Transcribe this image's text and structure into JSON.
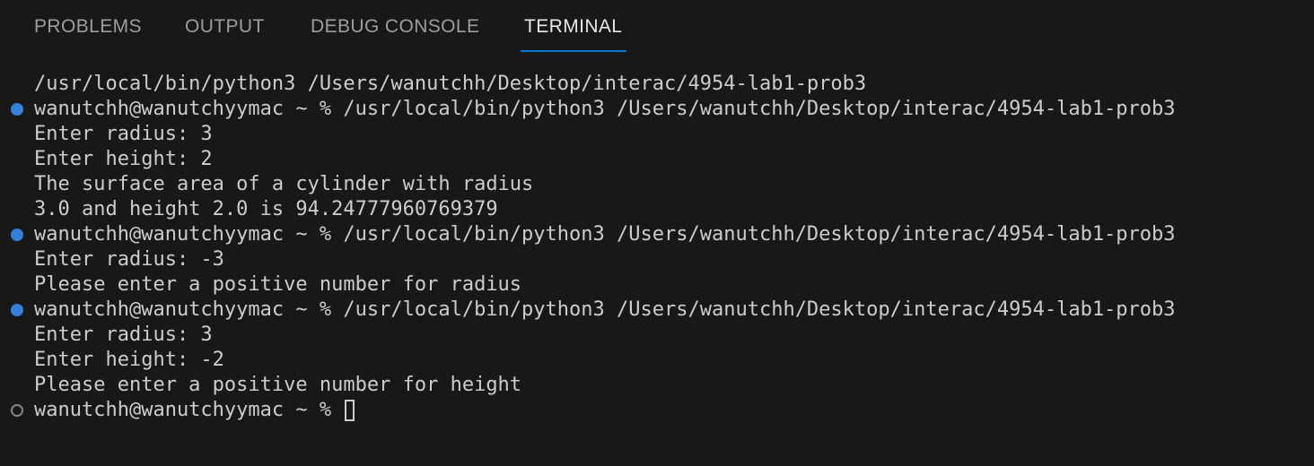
{
  "tabs": [
    {
      "label": "PROBLEMS",
      "active": false
    },
    {
      "label": "OUTPUT",
      "active": false
    },
    {
      "label": "DEBUG CONSOLE",
      "active": false
    },
    {
      "label": "TERMINAL",
      "active": true
    }
  ],
  "colors": {
    "background": "#181818",
    "text": "#cccccc",
    "active_tab_underline": "#0078d4",
    "success_decoration": "#3794ff"
  },
  "terminal": {
    "lines": [
      {
        "text": "/usr/local/bin/python3 /Users/wanutchh/Desktop/interac/4954-lab1-prob3",
        "decoration": "none"
      },
      {
        "text": "wanutchh@wanutchyymac ~ % /usr/local/bin/python3 /Users/wanutchh/Desktop/interac/4954-lab1-prob3",
        "decoration": "success"
      },
      {
        "text": "Enter radius: 3",
        "decoration": "none"
      },
      {
        "text": "Enter height: 2",
        "decoration": "none"
      },
      {
        "text": "The surface area of a cylinder with radius",
        "decoration": "none"
      },
      {
        "text": "3.0 and height 2.0 is 94.24777960769379",
        "decoration": "none"
      },
      {
        "text": "wanutchh@wanutchyymac ~ % /usr/local/bin/python3 /Users/wanutchh/Desktop/interac/4954-lab1-prob3",
        "decoration": "success"
      },
      {
        "text": "Enter radius: -3",
        "decoration": "none"
      },
      {
        "text": "Please enter a positive number for radius",
        "decoration": "none"
      },
      {
        "text": "wanutchh@wanutchyymac ~ % /usr/local/bin/python3 /Users/wanutchh/Desktop/interac/4954-lab1-prob3",
        "decoration": "success"
      },
      {
        "text": "Enter radius: 3",
        "decoration": "none"
      },
      {
        "text": "Enter height: -2",
        "decoration": "none"
      },
      {
        "text": "Please enter a positive number for height",
        "decoration": "none"
      }
    ],
    "prompt": {
      "text": "wanutchh@wanutchyymac ~ % ",
      "decoration": "pending"
    }
  }
}
